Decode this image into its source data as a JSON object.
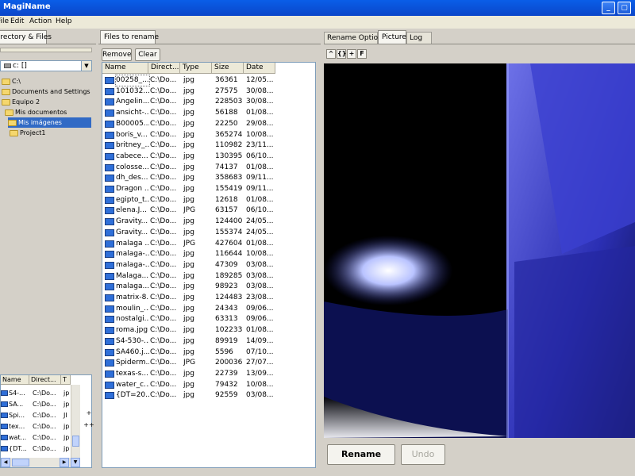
{
  "window": {
    "title": "MagiName"
  },
  "menu": [
    "File",
    "Edit",
    "Action",
    "Help"
  ],
  "left": {
    "tab_label": "Directory & Files",
    "drive": "c: []",
    "tree": [
      {
        "label": "C:\\",
        "indent": 0
      },
      {
        "label": "Documents and Settings",
        "indent": 1
      },
      {
        "label": "Equipo 2",
        "indent": 1
      },
      {
        "label": "Mis documentos",
        "indent": 2
      },
      {
        "label": "Mis imágenes",
        "indent": 3,
        "selected": true
      },
      {
        "label": "Project1",
        "indent": 4
      }
    ],
    "list_headers": [
      "Name",
      "Direct...",
      "T"
    ],
    "list_rows": [
      [
        "S4-...",
        "C:\\Do...",
        "jp"
      ],
      [
        "SA...",
        "C:\\Do...",
        "jp"
      ],
      [
        "Spi...",
        "C:\\Do...",
        "JI"
      ],
      [
        "tex...",
        "C:\\Do...",
        "jp"
      ],
      [
        "wat...",
        "C:\\Do...",
        "jp"
      ],
      [
        "{DT...",
        "C:\\Do...",
        "jp"
      ]
    ],
    "add_label": "+",
    "addall_label": "++"
  },
  "middle": {
    "tab_label": "Files to rename",
    "remove_label": "Remove",
    "clear_label": "Clear",
    "headers": [
      "Name",
      "Direct...",
      "Type",
      "Size",
      "Date"
    ],
    "rows": [
      [
        "00258_...",
        "C:\\Do...",
        "jpg",
        "36361",
        "12/05..."
      ],
      [
        "101032...",
        "C:\\Do...",
        "jpg",
        "27575",
        "30/08..."
      ],
      [
        "Angelin...",
        "C:\\Do...",
        "jpg",
        "228503",
        "30/08..."
      ],
      [
        "ansicht-...",
        "C:\\Do...",
        "jpg",
        "56188",
        "01/08..."
      ],
      [
        "B00005...",
        "C:\\Do...",
        "jpg",
        "22250",
        "29/08..."
      ],
      [
        "boris_v...",
        "C:\\Do...",
        "jpg",
        "365274",
        "10/08..."
      ],
      [
        "britney_...",
        "C:\\Do...",
        "jpg",
        "110982",
        "23/11..."
      ],
      [
        "cabece...",
        "C:\\Do...",
        "jpg",
        "130395",
        "06/10..."
      ],
      [
        "colosse...",
        "C:\\Do...",
        "jpg",
        "74137",
        "01/08..."
      ],
      [
        "dh_des...",
        "C:\\Do...",
        "jpg",
        "358683",
        "09/11..."
      ],
      [
        "Dragon ...",
        "C:\\Do...",
        "jpg",
        "155419",
        "09/11..."
      ],
      [
        "egipto_t...",
        "C:\\Do...",
        "jpg",
        "12618",
        "01/08..."
      ],
      [
        "elena.J...",
        "C:\\Do...",
        "JPG",
        "63157",
        "06/10..."
      ],
      [
        "Gravity...",
        "C:\\Do...",
        "jpg",
        "124400",
        "24/05..."
      ],
      [
        "Gravity...",
        "C:\\Do...",
        "jpg",
        "155374",
        "24/05..."
      ],
      [
        "malaga ...",
        "C:\\Do...",
        "JPG",
        "427604",
        "01/08..."
      ],
      [
        "malaga-...",
        "C:\\Do...",
        "jpg",
        "116644",
        "10/08..."
      ],
      [
        "malaga-...",
        "C:\\Do...",
        "jpg",
        "47309",
        "03/08..."
      ],
      [
        "Malaga...",
        "C:\\Do...",
        "jpg",
        "189285",
        "03/08..."
      ],
      [
        "malaga...",
        "C:\\Do...",
        "jpg",
        "98923",
        "03/08..."
      ],
      [
        "matrix-8...",
        "C:\\Do...",
        "jpg",
        "124483",
        "23/08..."
      ],
      [
        "moulin_...",
        "C:\\Do...",
        "jpg",
        "24343",
        "09/06..."
      ],
      [
        "nostalgi...",
        "C:\\Do...",
        "jpg",
        "63313",
        "09/06..."
      ],
      [
        "roma.jpg",
        "C:\\Do...",
        "jpg",
        "102233",
        "01/08..."
      ],
      [
        "S4-530-...",
        "C:\\Do...",
        "jpg",
        "89919",
        "14/09..."
      ],
      [
        "SA460.j...",
        "C:\\Do...",
        "jpg",
        "5596",
        "07/10..."
      ],
      [
        "Spiderm...",
        "C:\\Do...",
        "JPG",
        "200036",
        "27/07..."
      ],
      [
        "texas-s...",
        "C:\\Do...",
        "jpg",
        "22739",
        "13/09..."
      ],
      [
        "water_c...",
        "C:\\Do...",
        "jpg",
        "79432",
        "10/08..."
      ],
      [
        "{DT=20...",
        "C:\\Do...",
        "jpg",
        "92559",
        "03/08..."
      ]
    ]
  },
  "right": {
    "tabs": [
      "Rename Option",
      "Picture",
      "Log"
    ],
    "active_tab": "Picture",
    "toolbar": [
      "^",
      "{}",
      "+",
      "F"
    ],
    "rename_label": "Rename",
    "undo_label": "Undo"
  }
}
